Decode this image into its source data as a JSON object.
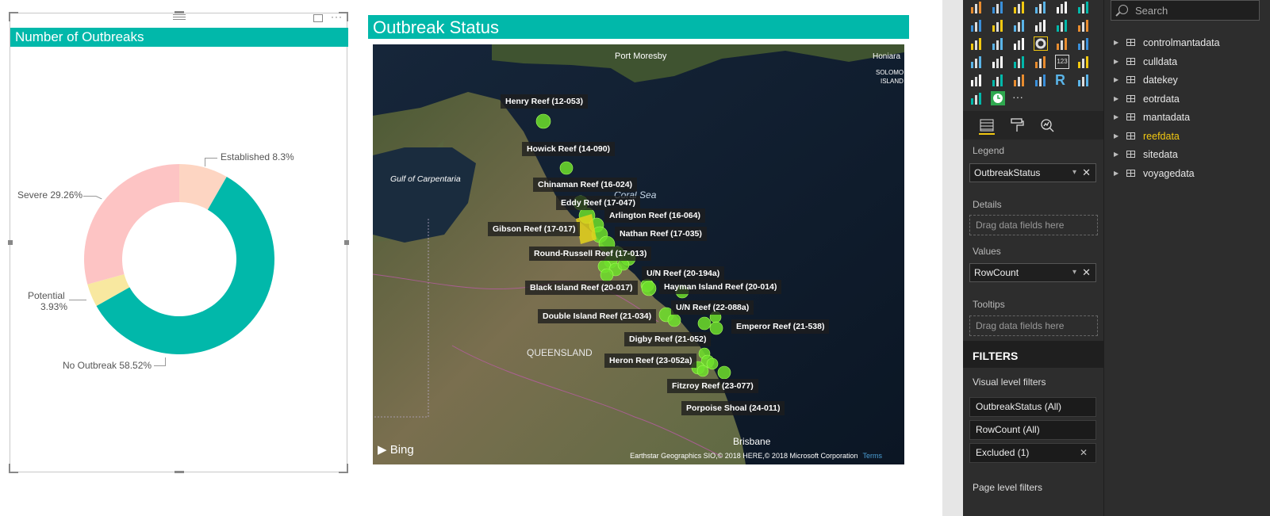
{
  "donut": {
    "title": "Number of Outbreaks",
    "labels": {
      "established": "Established 8.3%",
      "severe": "Severe 29.26%",
      "potential_1": "Potential",
      "potential_2": "3.93%",
      "no_outbreak": "No Outbreak 58.52%"
    }
  },
  "chart_data": {
    "type": "pie",
    "title": "Number of Outbreaks",
    "categories": [
      "Established",
      "No Outbreak",
      "Potential",
      "Severe"
    ],
    "values": [
      8.3,
      58.52,
      3.93,
      29.26
    ],
    "colors": [
      "#fdd5c2",
      "#01b8aa",
      "#f8e8a0",
      "#fdc4c4"
    ],
    "inner_radius_ratio": 0.6
  },
  "map": {
    "title": "Outbreak Status",
    "places": {
      "port_moresby": "Port Moresby",
      "honiara": "Honiara",
      "solomon_1": "SOLOMO",
      "solomon_2": "ISLAND",
      "gulf": "Gulf of Carpentaria",
      "coral_sea": "Coral Sea",
      "queensland": "QUEENSLAND",
      "brisbane": "Brisbane"
    },
    "reefs": [
      "Henry Reef (12-053)",
      "Howick Reef (14-090)",
      "Chinaman Reef (16-024)",
      "Eddy Reef (17-047)",
      "Arlington Reef (16-064)",
      "Gibson Reef (17-017)",
      "Nathan Reef (17-035)",
      "Round-Russell Reef (17-013)",
      "U/N Reef (20-194a)",
      "Black Island Reef (20-017)",
      "Hayman Island Reef (20-014)",
      "U/N Reef (22-088a)",
      "Double Island Reef (21-034)",
      "Emperor Reef (21-538)",
      "Digby Reef (21-052)",
      "Heron Reef (23-052a)",
      "Fitzroy Reef (23-077)",
      "Porpoise Shoal (24-011)"
    ],
    "bing": "Bing",
    "attribution": "Earthstar Geographics SIO,© 2018 HERE,© 2018 Microsoft Corporation",
    "terms": "Terms"
  },
  "viz_pane": {
    "legend_label": "Legend",
    "legend_field": "OutbreakStatus",
    "details_label": "Details",
    "details_placeholder": "Drag data fields here",
    "values_label": "Values",
    "values_field": "RowCount",
    "tooltips_label": "Tooltips",
    "tooltips_placeholder": "Drag data fields here",
    "filters_title": "FILTERS",
    "visual_filters_label": "Visual level filters",
    "filters": [
      "OutbreakStatus (All)",
      "RowCount (All)",
      "Excluded (1)"
    ],
    "page_filters_label": "Page level filters",
    "more": "···",
    "r_label": "R",
    "num_label": "123"
  },
  "fields_pane": {
    "search_placeholder": "Search",
    "tables": [
      "controlmantadata",
      "culldata",
      "datekey",
      "eotrdata",
      "mantadata",
      "reefdata",
      "sitedata",
      "voyagedata"
    ],
    "selected": "reefdata"
  }
}
